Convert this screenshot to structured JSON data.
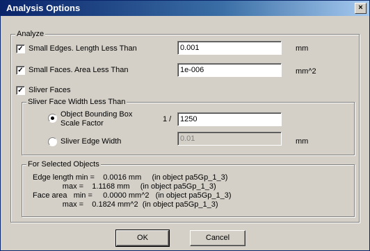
{
  "window": {
    "title": "Analysis Options",
    "close_glyph": "×"
  },
  "analyze": {
    "legend": "Analyze",
    "small_edges": {
      "checked": true,
      "label": "Small Edges. Length Less Than",
      "value": "0.001",
      "unit": "mm"
    },
    "small_faces": {
      "checked": true,
      "label": "Small Faces. Area Less Than",
      "value": "1e-006",
      "unit": "mm^2"
    },
    "sliver_faces": {
      "checked": true,
      "label": "Sliver Faces"
    }
  },
  "sliver_width": {
    "legend": "Sliver Face Width Less Than",
    "bbox_option": {
      "selected": true,
      "label_line1": "Object Bounding Box",
      "label_line2": "Scale Factor",
      "prefix": "1 /",
      "value": "1250"
    },
    "edge_option": {
      "selected": false,
      "label": "Sliver Edge Width",
      "value": "0.01",
      "unit": "mm"
    }
  },
  "selected_objects": {
    "legend": "For Selected Objects",
    "lines": [
      "Edge length min =    0.0016 mm     (in object pa5Gp_1_3)",
      "              max =    1.1168 mm     (in object pa5Gp_1_3)",
      "Face area   min =     0.0000 mm^2   (in object pa5Gp_1_3)",
      "              max =    0.1824 mm^2  (in object pa5Gp_1_3)"
    ]
  },
  "buttons": {
    "ok": "OK",
    "cancel": "Cancel"
  }
}
